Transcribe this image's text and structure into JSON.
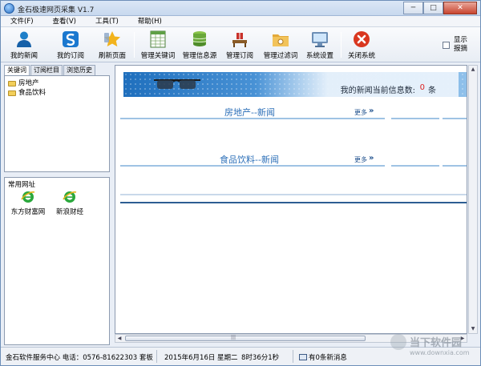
{
  "window": {
    "title": "金石极速网页采集 V1.7",
    "minimize": "─",
    "maximize": "□",
    "close": "✕"
  },
  "menu": [
    "文件(F)",
    "查看(V)",
    "工具(T)",
    "帮助(H)"
  ],
  "toolbar": {
    "buttons": [
      "我的新闻",
      "我的订阅",
      "刷新页面",
      "管理关键词",
      "管理信息源",
      "管理订阅",
      "管理过滤词",
      "系统设置",
      "关闭系统"
    ],
    "show_ads_label": "显示\n报摘"
  },
  "left": {
    "tabs": [
      "关键词",
      "订阅栏目",
      "浏览历史"
    ],
    "tree": [
      "房地产",
      "食品饮料"
    ],
    "links_header": "常用网址",
    "links": [
      "东方财富网",
      "新浪财经"
    ]
  },
  "content": {
    "banner": {
      "text": "我的新闻当前信息数:",
      "count": "0",
      "unit": "条"
    },
    "sections": [
      {
        "title": "房地产--新闻",
        "more": "更多"
      },
      {
        "title": "食品饮料--新闻",
        "more": "更多"
      }
    ],
    "more_arrows": "»"
  },
  "status": {
    "company": "金石软件服务中心 电话：0576-81622303  套板",
    "date": "2015年6月16日  星期二",
    "time": "8时36分1秒",
    "messages": "有0条新消息"
  },
  "watermark": {
    "cn": "当下软件园",
    "en": "www.downxia.com"
  },
  "colors": {
    "accent": "#2c6fb8",
    "count": "#dd2222",
    "banner_start": "#1f6fbd"
  }
}
